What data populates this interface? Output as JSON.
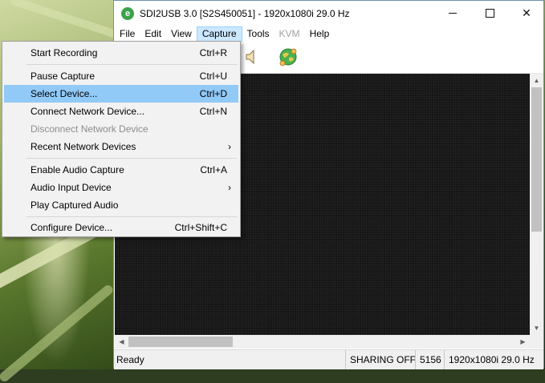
{
  "window": {
    "title": "SDI2USB 3.0 [S2S450051] - 1920x1080i 29.0 Hz",
    "app_icon_letter": "e",
    "minimize": "—",
    "maximize": "☐",
    "close": "✕"
  },
  "menubar": [
    {
      "label": "File"
    },
    {
      "label": "Edit"
    },
    {
      "label": "View"
    },
    {
      "label": "Capture",
      "active": true
    },
    {
      "label": "Tools"
    },
    {
      "label": "KVM",
      "disabled": true
    },
    {
      "label": "Help"
    }
  ],
  "capture_menu": {
    "items": [
      {
        "label": "Start Recording",
        "shortcut": "Ctrl+R"
      },
      {
        "label": "Pause Capture",
        "shortcut": "Ctrl+U"
      },
      {
        "label": "Select Device...",
        "shortcut": "Ctrl+D",
        "highlighted": true
      },
      {
        "label": "Connect Network Device...",
        "shortcut": "Ctrl+N"
      },
      {
        "label": "Disconnect Network Device",
        "shortcut": "",
        "disabled": true
      },
      {
        "label": "Recent Network Devices",
        "submenu": true
      },
      {
        "label": "Enable Audio Capture",
        "shortcut": "Ctrl+A"
      },
      {
        "label": "Audio Input Device",
        "submenu": true
      },
      {
        "label": "Play Captured Audio",
        "shortcut": ""
      },
      {
        "label": "Configure Device...",
        "shortcut": "Ctrl+Shift+C"
      }
    ],
    "submenu_arrow": "›"
  },
  "toolbar": {
    "icons": [
      "speaker-icon",
      "globe-network-icon"
    ]
  },
  "scroll": {
    "up": "▲",
    "down": "▼",
    "left": "◀",
    "right": "▶"
  },
  "status": {
    "ready": "Ready",
    "sharing": "SHARING OFF",
    "frames": "5156",
    "resolution": "1920x1080i 29.0 Hz"
  }
}
